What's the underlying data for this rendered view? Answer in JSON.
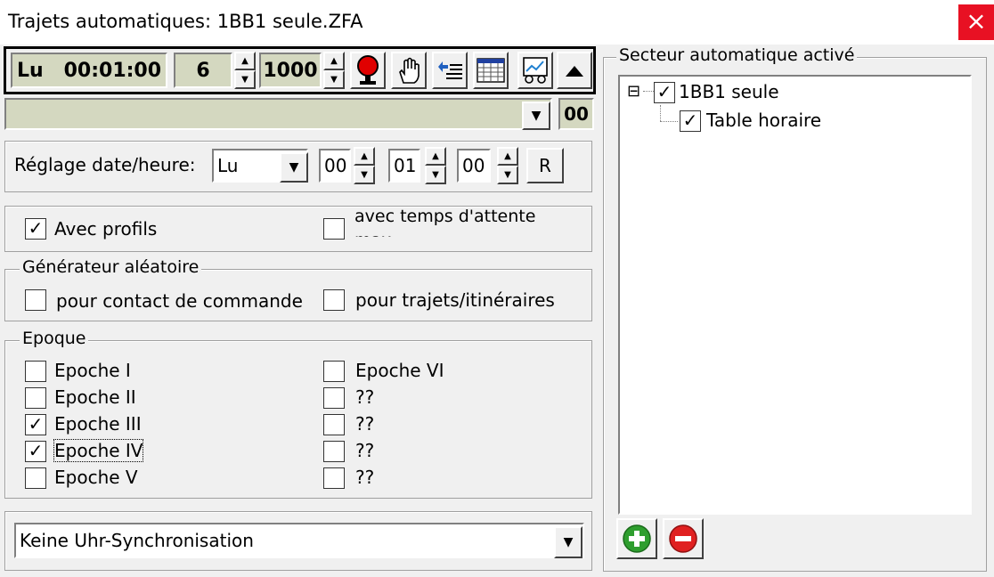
{
  "window": {
    "title": "Trajets automatiques: 1BB1 seule.ZFA",
    "close_glyph": "×"
  },
  "toolbar": {
    "day_time": "Lu   00:01:00",
    "step": "6",
    "speed": "1000"
  },
  "status": {
    "value": "",
    "code": "00"
  },
  "datetime": {
    "label": "Réglage date/heure:",
    "day": "Lu",
    "hour": "00",
    "minute": "01",
    "second": "00",
    "reset_label": "R"
  },
  "options": {
    "profiles_label": "Avec profils",
    "profiles_checked": true,
    "wait_label": "avec temps d'attente max",
    "wait_checked": false
  },
  "random": {
    "legend": "Générateur aléatoire",
    "contact_label": "pour contact de commande",
    "contact_checked": false,
    "routes_label": "pour trajets/itinéraires",
    "routes_checked": false
  },
  "epoch": {
    "legend": "Epoque",
    "left": [
      {
        "label": "Epoche I",
        "checked": false
      },
      {
        "label": "Epoche II",
        "checked": false
      },
      {
        "label": "Epoche III",
        "checked": true
      },
      {
        "label": "Epoche IV",
        "checked": true
      },
      {
        "label": "Epoche V",
        "checked": false
      }
    ],
    "right": [
      {
        "label": "Epoche VI",
        "checked": false
      },
      {
        "label": "??",
        "checked": false
      },
      {
        "label": "??",
        "checked": false
      },
      {
        "label": "??",
        "checked": false
      },
      {
        "label": "??",
        "checked": false
      }
    ]
  },
  "sync": {
    "value": "Keine Uhr-Synchronisation"
  },
  "sector": {
    "legend": "Secteur automatique activé",
    "tree": [
      {
        "label": "1BB1 seule",
        "checked": true,
        "expander": "⊟"
      },
      {
        "label": "Table horaire",
        "checked": true
      }
    ]
  },
  "colors": {
    "lcd_bg": "#d4d8c0",
    "close_bg": "#e81123",
    "add_green": "#2e9e2e",
    "remove_red": "#e02020"
  }
}
